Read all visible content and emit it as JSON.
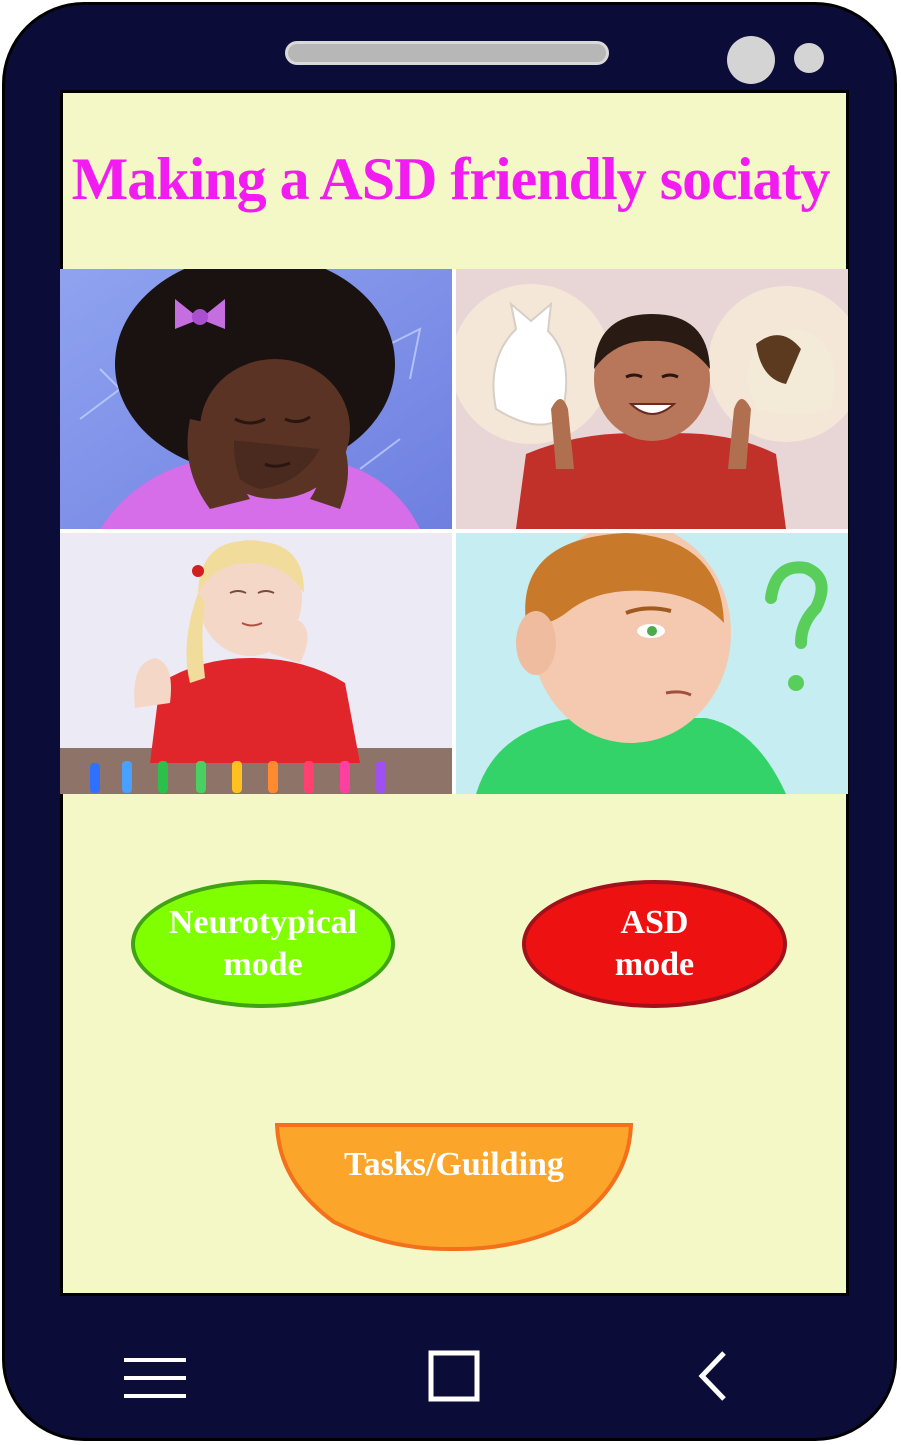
{
  "header": {
    "title": "Making a ASD friendly sociaty"
  },
  "images": [
    {
      "name": "girl-covering-ears",
      "description": "child-illustration"
    },
    {
      "name": "boy-happy-with-cats",
      "description": "child-illustration"
    },
    {
      "name": "girl-with-crayons",
      "description": "child-illustration"
    },
    {
      "name": "boy-with-question-mark",
      "description": "child-illustration"
    }
  ],
  "buttons": {
    "neurotypical_label": "Neurotypical\nmode",
    "asd_label": "ASD\nmode",
    "tasks_label": "Tasks/Guilding"
  },
  "colors": {
    "title": "#f21cf2",
    "screen_bg": "#f3f8c6",
    "neurotypical": "#80ff00",
    "asd": "#ee1111",
    "tasks": "#fba52a",
    "phone_body": "#0c0c38"
  },
  "nav": {
    "menu_icon": "menu-icon",
    "home_icon": "square-home-icon",
    "back_icon": "back-chevron-icon"
  }
}
